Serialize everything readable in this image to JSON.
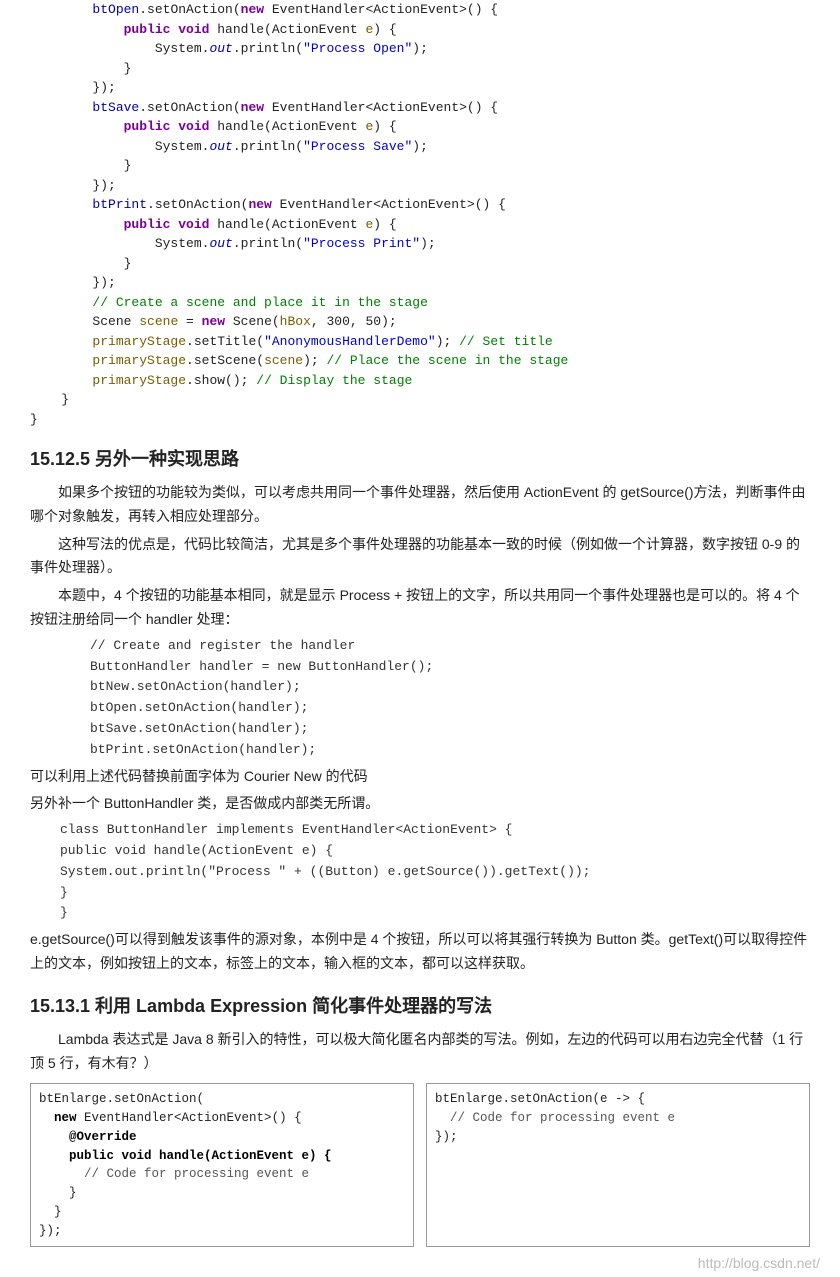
{
  "code1": {
    "l1a": "btOpen",
    "l1b": ".setOnAction(",
    "l1c": "new",
    "l1d": " EventHandler<ActionEvent>() {",
    "l2a": "public void",
    "l2b": " handle(ActionEvent ",
    "l2c": "e",
    "l2d": ") {",
    "l3a": "System.",
    "l3b": "out",
    "l3c": ".println(",
    "l3d": "\"Process Open\"",
    "l3e": ");",
    "l4": "}",
    "l5": "});",
    "l6a": "btSave",
    "l6b": ".setOnAction(",
    "l6c": "new",
    "l6d": " EventHandler<ActionEvent>() {",
    "l7a": "public void",
    "l7b": " handle(ActionEvent ",
    "l7c": "e",
    "l7d": ") {",
    "l8a": "System.",
    "l8b": "out",
    "l8c": ".println(",
    "l8d": "\"Process Save\"",
    "l8e": ");",
    "l9": "}",
    "l10": "});",
    "l11a": "btPrint",
    "l11b": ".setOnAction(",
    "l11c": "new",
    "l11d": " EventHandler<ActionEvent>() {",
    "l12a": "public void",
    "l12b": " handle(ActionEvent ",
    "l12c": "e",
    "l12d": ") {",
    "l13a": "System.",
    "l13b": "out",
    "l13c": ".println(",
    "l13d": "\"Process Print\"",
    "l13e": ");",
    "l14": "}",
    "l15": "});",
    "l16": "// Create a scene and place it in the stage",
    "l17a": "Scene ",
    "l17b": "scene",
    "l17c": " = ",
    "l17d": "new",
    "l17e": " Scene(",
    "l17f": "hBox",
    "l17g": ", 300, 50);",
    "l18a": "primaryStage",
    "l18b": ".setTitle(",
    "l18c": "\"AnonymousHandlerDemo\"",
    "l18d": "); ",
    "l18e": "// Set title",
    "l19a": "primaryStage",
    "l19b": ".setScene(",
    "l19c": "scene",
    "l19d": "); ",
    "l19e": "// Place the scene in the stage",
    "l20a": "primaryStage",
    "l20b": ".show(); ",
    "l20c": "// Display the stage",
    "l21": "}",
    "l22": "}"
  },
  "h1": "15.12.5 另外一种实现思路",
  "p1": "如果多个按钮的功能较为类似，可以考虑共用同一个事件处理器，然后使用 ActionEvent 的 getSource()方法，判断事件由哪个对象触发，再转入相应处理部分。",
  "p2": "这种写法的优点是，代码比较简洁，尤其是多个事件处理器的功能基本一致的时候（例如做一个计算器，数字按钮 0-9 的事件处理器）。",
  "p3": "本题中，4 个按钮的功能基本相同，就是显示 Process + 按钮上的文字，所以共用同一个事件处理器也是可以的。将 4 个按钮注册给同一个 handler 处理：",
  "cb1": {
    "l1": "// Create and register the handler",
    "l2": "ButtonHandler handler = new ButtonHandler();",
    "l3": "btNew.setOnAction(handler);",
    "l4": "btOpen.setOnAction(handler);",
    "l5": "btSave.setOnAction(handler);",
    "l6": "btPrint.setOnAction(handler);"
  },
  "p4": "可以利用上述代码替换前面字体为 Courier New 的代码",
  "p5": "另外补一个 ButtonHandler 类，是否做成内部类无所谓。",
  "cb2": {
    "l1": "class ButtonHandler implements EventHandler<ActionEvent> {",
    "l2": "  public void handle(ActionEvent e) {",
    "l3": "    System.out.println(\"Process \" + ((Button) e.getSource()).getText());",
    "l4": "  }",
    "l5": "}"
  },
  "p6": "e.getSource()可以得到触发该事件的源对象，本例中是 4 个按钮，所以可以将其强行转换为 Button 类。getText()可以取得控件上的文本，例如按钮上的文本，标签上的文本，输入框的文本，都可以这样获取。",
  "h2": "15.13.1 利用 Lambda Expression 简化事件处理器的写法",
  "p7": "Lambda 表达式是 Java 8 新引入的特性，可以极大简化匿名内部类的写法。例如，左边的代码可以用右边完全代替（1 行顶 5 行，有木有？）",
  "left": {
    "l1": "btEnlarge.setOnAction(",
    "l2a": "new",
    "l2b": " EventHandler<ActionEvent>() {",
    "l3": "@Override",
    "l4a": "public void",
    "l4b": " handle(ActionEvent e) {",
    "l5": "// Code for processing event e",
    "l6": "}",
    "l7": "}",
    "l8": "});"
  },
  "right": {
    "l1": "btEnlarge.setOnAction(e -> {",
    "l2": "// Code for processing event e",
    "l3": "});"
  },
  "watermark": "http://blog.csdn.net/"
}
